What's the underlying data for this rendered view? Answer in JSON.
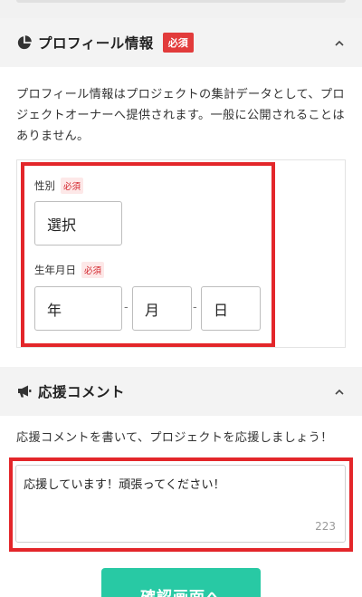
{
  "profile_section": {
    "title": "プロフィール情報",
    "required_badge": "必須",
    "description": "プロフィール情報はプロジェクトの集計データとして、プロジェクトオーナーへ提供されます。一般に公開されることはありません。",
    "gender": {
      "label": "性別",
      "required": "必須",
      "value": "選択"
    },
    "birthdate": {
      "label": "生年月日",
      "required": "必須",
      "year": "年",
      "month": "月",
      "day": "日",
      "separator": "-"
    }
  },
  "comment_section": {
    "title": "応援コメント",
    "description": "応援コメントを書いて、プロジェクトを応援しましょう！",
    "comment_value": "応援しています！頑張ってください！",
    "char_count": "223"
  },
  "confirm_button": {
    "label": "確認画面へ"
  },
  "colors": {
    "accent_red": "#e3262a",
    "button_teal": "#28c9a4",
    "header_bg": "#f3f3f3"
  },
  "icons": {
    "profile": "pie-chart-icon",
    "comment": "megaphone-icon",
    "collapse": "chevron-up-icon"
  }
}
